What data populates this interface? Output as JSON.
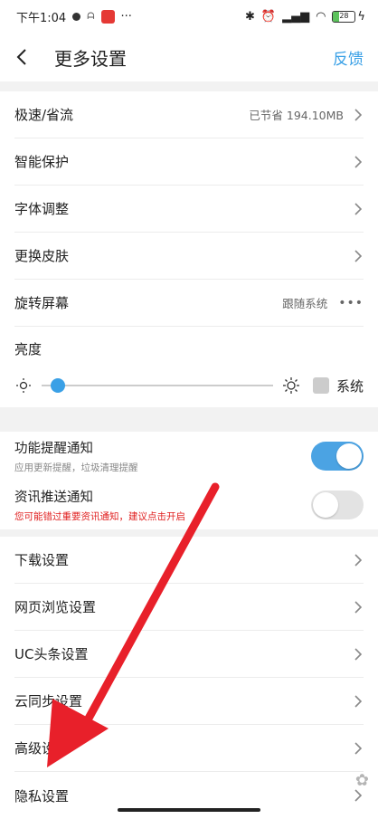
{
  "status": {
    "time": "下午1:04",
    "battery": "28"
  },
  "header": {
    "title": "更多设置",
    "feedback": "反馈"
  },
  "group1": [
    {
      "label": "极速/省流",
      "value": "已节省 194.10MB"
    },
    {
      "label": "智能保护"
    },
    {
      "label": "字体调整"
    },
    {
      "label": "更换皮肤"
    },
    {
      "label": "旋转屏幕",
      "value": "跟随系统"
    }
  ],
  "brightness": {
    "label": "亮度",
    "level_percent": 7,
    "system_label": "系统"
  },
  "notifications": [
    {
      "title": "功能提醒通知",
      "subtitle": "应用更新提醒，垃圾清理提醒",
      "on": true
    },
    {
      "title": "资讯推送通知",
      "subtitle": "您可能错过重要资讯通知，建议点击开启",
      "on": false
    }
  ],
  "group3": [
    {
      "label": "下载设置"
    },
    {
      "label": "网页浏览设置"
    },
    {
      "label": "UC头条设置"
    },
    {
      "label": "云同步设置"
    },
    {
      "label": "高级设置"
    },
    {
      "label": "隐私设置"
    }
  ],
  "colors": {
    "accent": "#3aa0e6",
    "arrow": "#e8202a",
    "warning": "#e02020"
  }
}
